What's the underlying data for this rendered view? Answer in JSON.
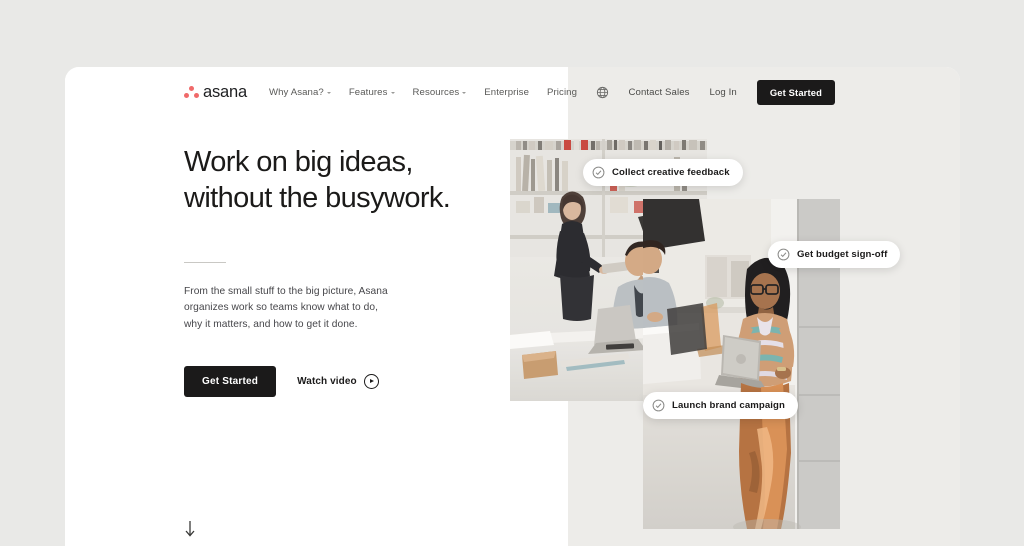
{
  "brand": {
    "name": "asana",
    "logo_icon": "asana-dots-logo",
    "accent_color": "#f06a6a",
    "dark_color": "#1b1a1a"
  },
  "nav": {
    "links": [
      {
        "label": "Why Asana?",
        "has_dropdown": true
      },
      {
        "label": "Features",
        "has_dropdown": true
      },
      {
        "label": "Resources",
        "has_dropdown": true
      },
      {
        "label": "Enterprise",
        "has_dropdown": false
      },
      {
        "label": "Pricing",
        "has_dropdown": false
      }
    ],
    "globe_icon": "globe-icon",
    "contact_sales": "Contact Sales",
    "log_in": "Log In",
    "get_started": "Get Started"
  },
  "hero": {
    "headline": "Work on big ideas,\nwithout the busywork.",
    "subcopy": "From the small stuff to the big picture, Asana\norganizes work so teams know what to do,\nwhy it matters, and how to get it done.",
    "primary_cta": "Get Started",
    "secondary_cta": "Watch video",
    "play_icon": "play-circle-icon",
    "scroll_icon": "arrow-down-icon"
  },
  "collage": {
    "photo_a_alt": "Two colleagues collaborating at a desk in a studio office",
    "photo_b_alt": "Woman with glasses holding a laptop in an open office",
    "cards": [
      {
        "label": "Collect creative feedback",
        "icon": "check-circle-icon"
      },
      {
        "label": "Get budget sign-off",
        "icon": "check-circle-icon"
      },
      {
        "label": "Launch brand campaign",
        "icon": "check-circle-icon"
      }
    ]
  },
  "theme": {
    "page_background": "#e9e9e7",
    "card_left_background": "#ffffff",
    "card_right_background": "#edece9"
  }
}
